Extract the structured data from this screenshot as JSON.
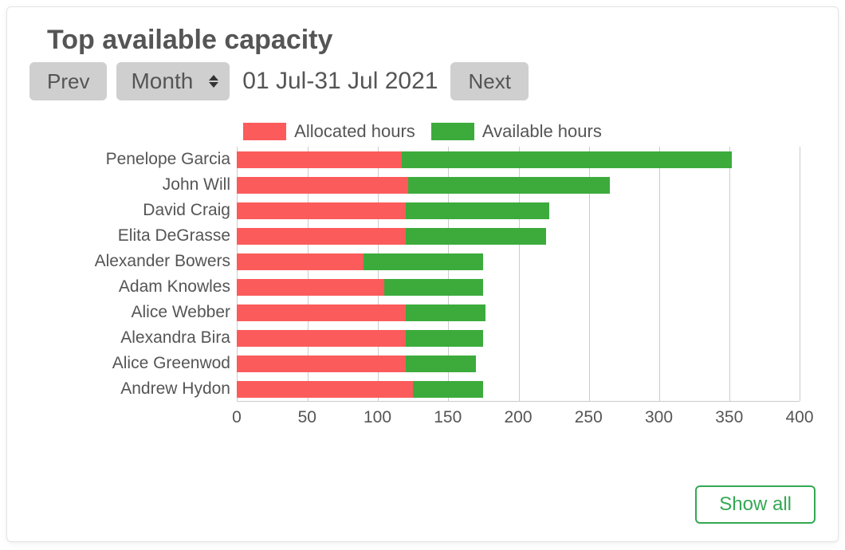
{
  "title": "Top available capacity",
  "controls": {
    "prev_label": "Prev",
    "next_label": "Next",
    "period_select_value": "Month",
    "range_text": "01 Jul-31 Jul 2021"
  },
  "legend": {
    "allocated": {
      "label": "Allocated hours",
      "color": "#fc5b5b"
    },
    "available": {
      "label": "Available hours",
      "color": "#3cab3c"
    }
  },
  "chart_data": {
    "type": "bar",
    "orientation": "horizontal",
    "stacked": true,
    "xlim": [
      0,
      400
    ],
    "xticks": [
      0,
      50,
      100,
      150,
      200,
      250,
      300,
      350,
      400
    ],
    "xlabel": "",
    "ylabel": "",
    "categories": [
      "Penelope Garcia",
      "John Will",
      "David Craig",
      "Elita DeGrasse",
      "Alexander Bowers",
      "Adam Knowles",
      "Alice Webber",
      "Alexandra Bira",
      "Alice Greenwod",
      "Andrew Hydon"
    ],
    "series": [
      {
        "name": "Allocated hours",
        "color": "#fc5b5b",
        "values": [
          117,
          122,
          120,
          120,
          90,
          105,
          120,
          120,
          120,
          125
        ]
      },
      {
        "name": "Available hours",
        "color": "#3cab3c",
        "values": [
          235,
          143,
          102,
          100,
          85,
          70,
          57,
          55,
          50,
          50
        ]
      }
    ]
  },
  "showall_label": "Show all"
}
